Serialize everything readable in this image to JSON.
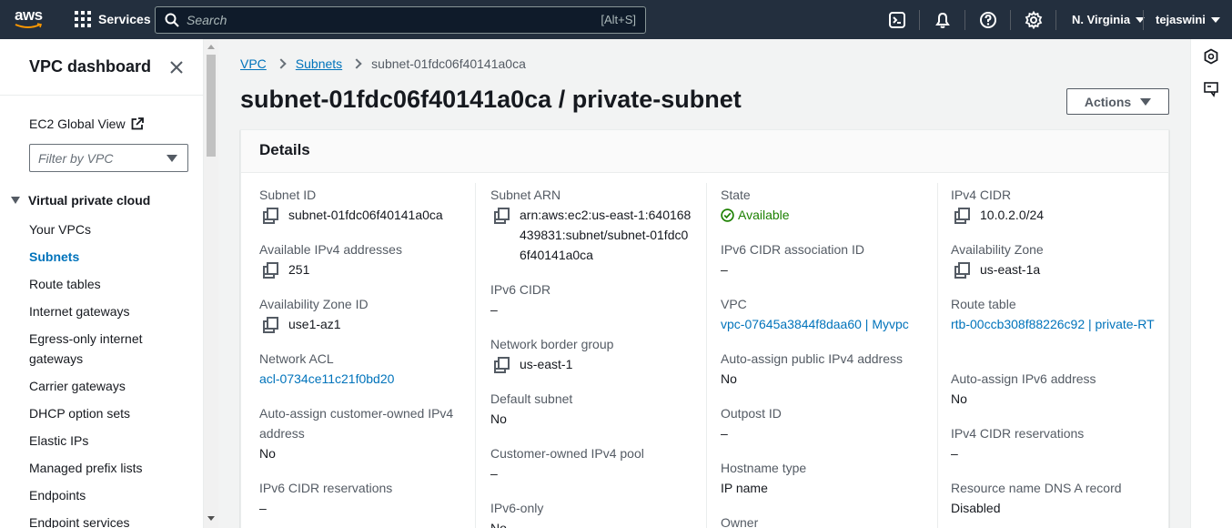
{
  "topnav": {
    "logo_text": "aws",
    "services_label": "Services",
    "search_placeholder": "Search",
    "search_shortcut": "[Alt+S]",
    "region": "N. Virginia",
    "user": "tejaswini",
    "icons": [
      "cloudshell-icon",
      "bell-icon",
      "help-icon",
      "gear-icon"
    ]
  },
  "sidebar": {
    "title": "VPC dashboard",
    "ec2_global_view": "EC2 Global View",
    "filter_placeholder": "Filter by VPC",
    "section": "Virtual private cloud",
    "items": [
      {
        "label": "Your VPCs",
        "active": false
      },
      {
        "label": "Subnets",
        "active": true
      },
      {
        "label": "Route tables",
        "active": false
      },
      {
        "label": "Internet gateways",
        "active": false
      },
      {
        "label": "Egress-only internet gateways",
        "active": false
      },
      {
        "label": "Carrier gateways",
        "active": false
      },
      {
        "label": "DHCP option sets",
        "active": false
      },
      {
        "label": "Elastic IPs",
        "active": false
      },
      {
        "label": "Managed prefix lists",
        "active": false
      },
      {
        "label": "Endpoints",
        "active": false
      },
      {
        "label": "Endpoint services",
        "active": false
      }
    ]
  },
  "breadcrumb": {
    "vpc": "VPC",
    "subnets": "Subnets",
    "current": "subnet-01fdc06f40141a0ca"
  },
  "page_title": "subnet-01fdc06f40141a0ca / private-subnet",
  "actions_label": "Actions",
  "details": {
    "heading": "Details",
    "col1": {
      "subnet_id_label": "Subnet ID",
      "subnet_id": "subnet-01fdc06f40141a0ca",
      "available_ipv4_label": "Available IPv4 addresses",
      "available_ipv4": "251",
      "az_id_label": "Availability Zone ID",
      "az_id": "use1-az1",
      "network_acl_label": "Network ACL",
      "network_acl": "acl-0734ce11c21f0bd20",
      "auto_assign_customer_label": "Auto-assign customer-owned IPv4 address",
      "auto_assign_customer": "No",
      "ipv6_cidr_res_label": "IPv6 CIDR reservations",
      "ipv6_cidr_res": "–"
    },
    "col2": {
      "subnet_arn_label": "Subnet ARN",
      "subnet_arn": "arn:aws:ec2:us-east-1:640168439831:subnet/subnet-01fdc06f40141a0ca",
      "ipv6_cidr_label": "IPv6 CIDR",
      "ipv6_cidr": "–",
      "nbg_label": "Network border group",
      "nbg": "us-east-1",
      "default_subnet_label": "Default subnet",
      "default_subnet": "No",
      "customer_pool_label": "Customer-owned IPv4 pool",
      "customer_pool": "–",
      "ipv6_only_label": "IPv6-only",
      "ipv6_only": "No"
    },
    "col3": {
      "state_label": "State",
      "state": "Available",
      "ipv6_assoc_label": "IPv6 CIDR association ID",
      "ipv6_assoc": "–",
      "vpc_label": "VPC",
      "vpc": "vpc-07645a3844f8daa60 | Myvpc",
      "auto_public_label": "Auto-assign public IPv4 address",
      "auto_public": "No",
      "outpost_label": "Outpost ID",
      "outpost": "–",
      "hostname_label": "Hostname type",
      "hostname": "IP name",
      "owner_label": "Owner"
    },
    "col4": {
      "ipv4_cidr_label": "IPv4 CIDR",
      "ipv4_cidr": "10.0.2.0/24",
      "az_label": "Availability Zone",
      "az": "us-east-1a",
      "route_table_label": "Route table",
      "route_table": "rtb-00ccb308f88226c92 | private-RT",
      "auto_ipv6_label": "Auto-assign IPv6 address",
      "auto_ipv6": "No",
      "ipv4_cidr_res_label": "IPv4 CIDR reservations",
      "ipv4_cidr_res": "–",
      "dns_a_label": "Resource name DNS A record",
      "dns_a": "Disabled"
    }
  },
  "colors": {
    "nav_bg": "#232f3e",
    "link": "#0073bb",
    "success": "#1d8102",
    "text": "#16191f",
    "label": "#545b64"
  }
}
